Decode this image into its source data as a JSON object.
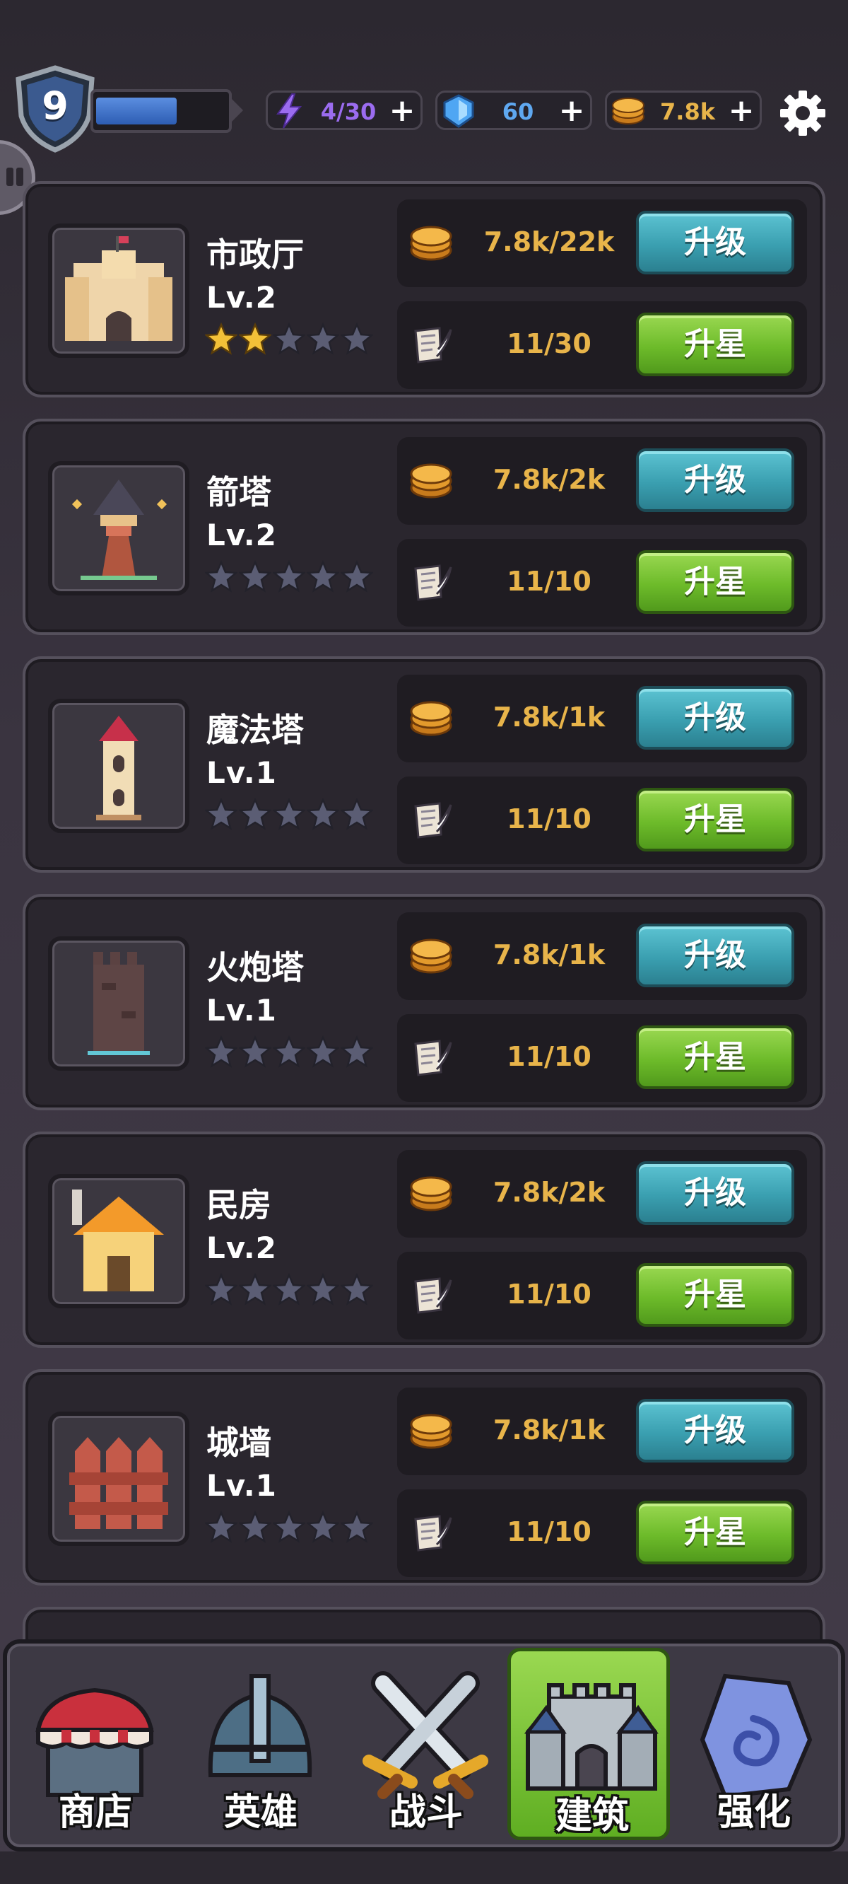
{
  "header": {
    "player_level": "9",
    "xp_fraction": 0.62,
    "energy": "4/30",
    "gems": "60",
    "coins": "7.8k",
    "plus": "+"
  },
  "colors": {
    "energy_text": "#9b6cf0",
    "gem_text": "#5fa8f0",
    "coin_text": "#e8b44a",
    "upgrade_button": "#3a9fb0",
    "star_button": "#6dbb2a"
  },
  "buildings": [
    {
      "name": "市政厅",
      "level": "Lv.2",
      "stars_filled": 2,
      "stars_total": 5,
      "coin_cost": "7.8k/22k",
      "scroll_cost": "11/30",
      "upgrade_label": "升级",
      "star_label": "升星",
      "icon": "town-hall-icon"
    },
    {
      "name": "箭塔",
      "level": "Lv.2",
      "stars_filled": 0,
      "stars_total": 5,
      "coin_cost": "7.8k/2k",
      "scroll_cost": "11/10",
      "upgrade_label": "升级",
      "star_label": "升星",
      "icon": "arrow-tower-icon"
    },
    {
      "name": "魔法塔",
      "level": "Lv.1",
      "stars_filled": 0,
      "stars_total": 5,
      "coin_cost": "7.8k/1k",
      "scroll_cost": "11/10",
      "upgrade_label": "升级",
      "star_label": "升星",
      "icon": "magic-tower-icon"
    },
    {
      "name": "火炮塔",
      "level": "Lv.1",
      "stars_filled": 0,
      "stars_total": 5,
      "coin_cost": "7.8k/1k",
      "scroll_cost": "11/10",
      "upgrade_label": "升级",
      "star_label": "升星",
      "icon": "cannon-tower-icon"
    },
    {
      "name": "民房",
      "level": "Lv.2",
      "stars_filled": 0,
      "stars_total": 5,
      "coin_cost": "7.8k/2k",
      "scroll_cost": "11/10",
      "upgrade_label": "升级",
      "star_label": "升星",
      "icon": "house-icon"
    },
    {
      "name": "城墙",
      "level": "Lv.1",
      "stars_filled": 0,
      "stars_total": 5,
      "coin_cost": "7.8k/1k",
      "scroll_cost": "11/10",
      "upgrade_label": "升级",
      "star_label": "升星",
      "icon": "wall-icon"
    }
  ],
  "nav": {
    "shop": "商店",
    "hero": "英雄",
    "battle": "战斗",
    "build": "建筑",
    "enhance": "强化",
    "active": "build"
  }
}
